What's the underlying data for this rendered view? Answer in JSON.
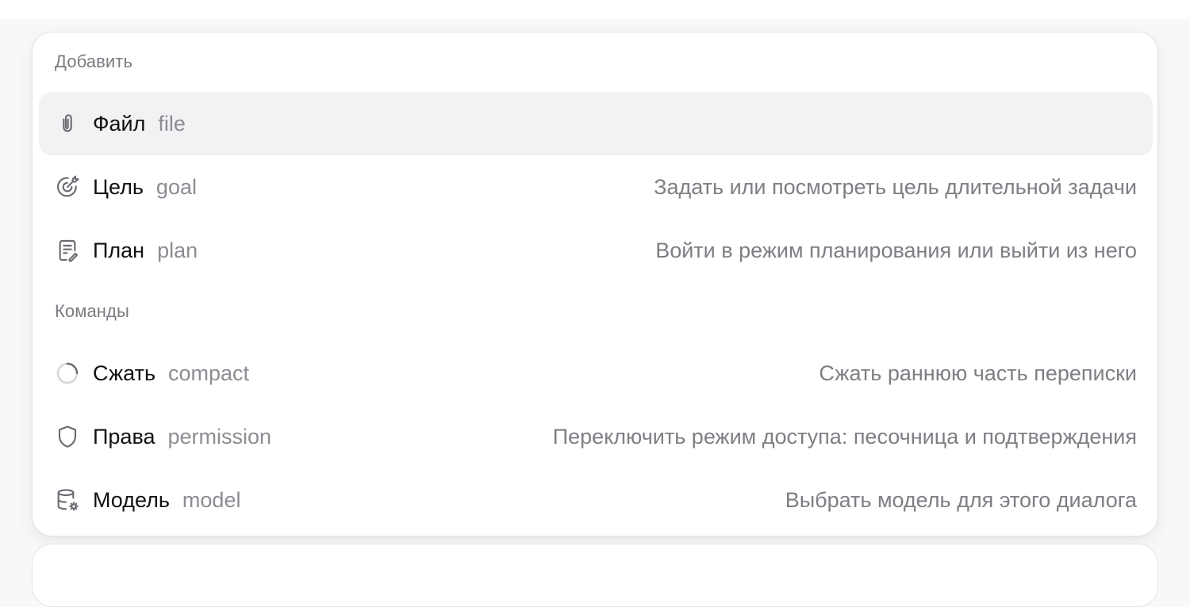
{
  "menu": {
    "sections": {
      "add": "Добавить",
      "commands": "Команды"
    },
    "items": [
      {
        "icon": "paperclip-icon",
        "name": "Файл",
        "cmd": "file",
        "desc": "",
        "active": true
      },
      {
        "icon": "target-icon",
        "name": "Цель",
        "cmd": "goal",
        "desc": "Задать или посмотреть цель длительной задачи"
      },
      {
        "icon": "plan-note-icon",
        "name": "План",
        "cmd": "plan",
        "desc": "Войти в режим планирования или выйти из него"
      },
      {
        "icon": "spinner-icon",
        "name": "Сжать",
        "cmd": "compact",
        "desc": "Сжать раннюю часть переписки"
      },
      {
        "icon": "shield-icon",
        "name": "Права",
        "cmd": "permission",
        "desc": "Переключить режим доступа: песочница и подтверждения"
      },
      {
        "icon": "database-gear-icon",
        "name": "Модель",
        "cmd": "model",
        "desc": "Выбрать модель для этого диалога"
      }
    ]
  },
  "colors": {
    "active_row": "#f2f2f4",
    "text_primary": "#111114",
    "text_secondary": "#7e7e85",
    "icon_stroke": "#6b6b72"
  }
}
